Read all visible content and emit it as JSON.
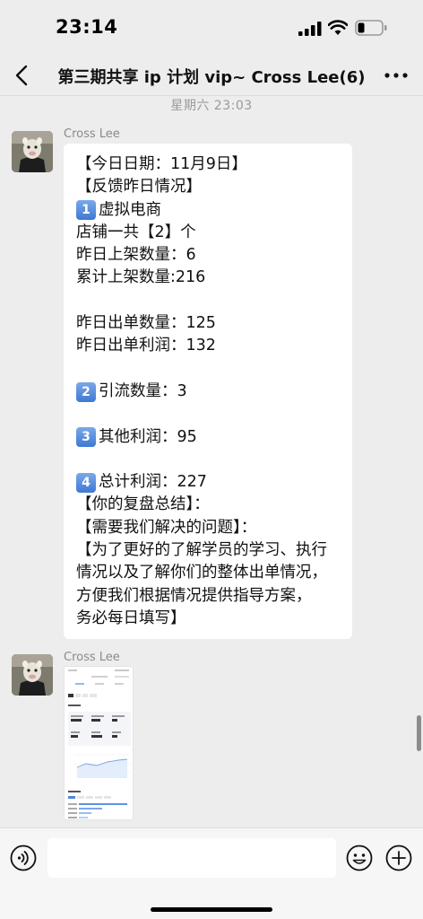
{
  "status_bar": {
    "time": "23:14"
  },
  "nav": {
    "title": "第三期共享 ip 计划 vip~ Cross Lee(6)"
  },
  "timestamp": "星期六 23:03",
  "messages": [
    {
      "sender": "Cross Lee",
      "lines": [
        {
          "text": "【今日日期：11月9日】"
        },
        {
          "text": "【反馈昨日情况】"
        },
        {
          "badge": "1",
          "text": "虚拟电商"
        },
        {
          "text": "店铺一共【2】个"
        },
        {
          "text": "昨日上架数量：6"
        },
        {
          "text": "累计上架数量:216"
        },
        {
          "text": ""
        },
        {
          "text": "昨日出单数量：125"
        },
        {
          "text": "昨日出单利润：132"
        },
        {
          "text": ""
        },
        {
          "badge": "2",
          "text": "引流数量：3"
        },
        {
          "text": ""
        },
        {
          "badge": "3",
          "text": "其他利润：95"
        },
        {
          "text": ""
        },
        {
          "badge": "4",
          "text": "总计利润：227"
        },
        {
          "text": "【你的复盘总结】："
        },
        {
          "text": "【需要我们解决的问题】："
        },
        {
          "text": "【为了更好的了解学员的学习、执行"
        },
        {
          "text": "情况以及了解你们的整体出单情况，"
        },
        {
          "text": "方便我们根据情况提供指导方案，"
        },
        {
          "text": "务必每日填写】"
        }
      ]
    },
    {
      "sender": "Cross Lee"
    }
  ],
  "colors": {
    "background": "#ededed",
    "bubble": "#ffffff",
    "input_bar": "#f6f6f6",
    "badge": "#3f78d4"
  }
}
